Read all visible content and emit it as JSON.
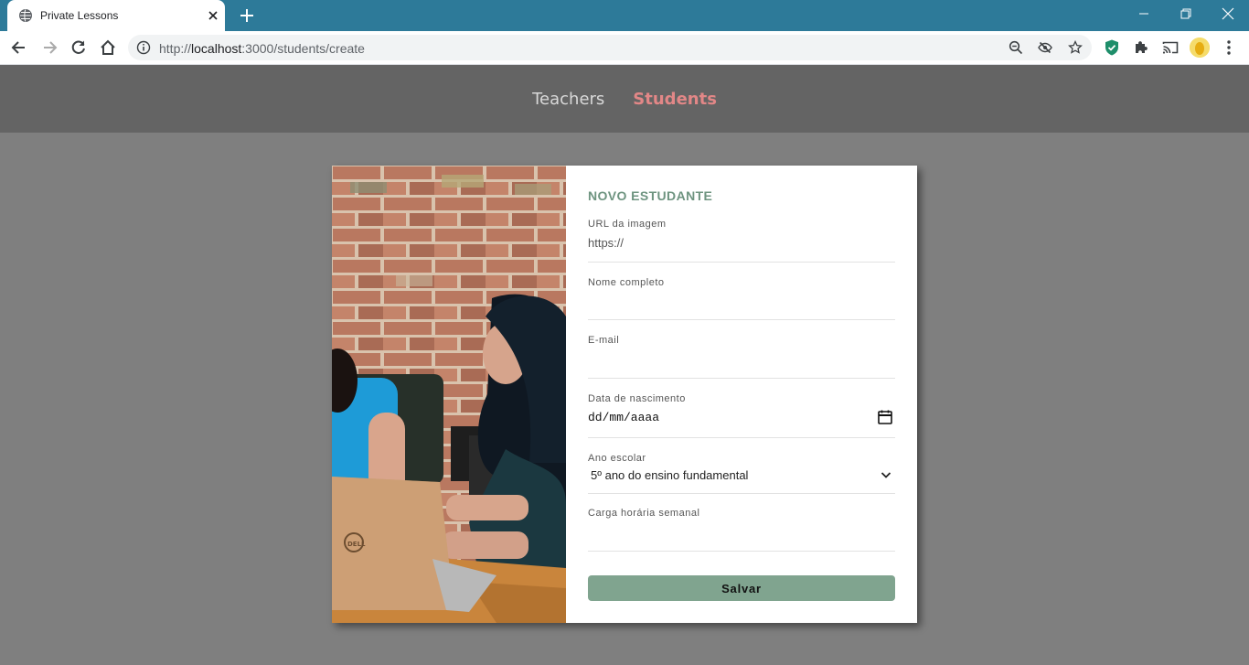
{
  "browser": {
    "tab_title": "Private Lessons",
    "url_prefix": "http://",
    "url_host": "localhost",
    "url_path": ":3000/students/create",
    "accent_color": "#2d7a99"
  },
  "nav": {
    "teachers_label": "Teachers",
    "students_label": "Students",
    "active": "Students",
    "active_color": "#e28787"
  },
  "form": {
    "title": "NOVO ESTUDANTE",
    "fields": {
      "avatar_url": {
        "label": "URL da imagem",
        "placeholder": "https://",
        "value": ""
      },
      "name": {
        "label": "Nome completo",
        "placeholder": "",
        "value": ""
      },
      "email": {
        "label": "E-mail",
        "placeholder": "",
        "value": ""
      },
      "birth": {
        "label": "Data de nascimento",
        "value": "dd/mm/aaaa"
      },
      "grade": {
        "label": "Ano escolar",
        "value": "5º ano do ensino fundamental"
      },
      "workload": {
        "label": "Carga horária semanal",
        "placeholder": "",
        "value": ""
      }
    },
    "submit_label": "Salvar",
    "button_color": "#80a48f",
    "title_color": "#6e9480"
  }
}
